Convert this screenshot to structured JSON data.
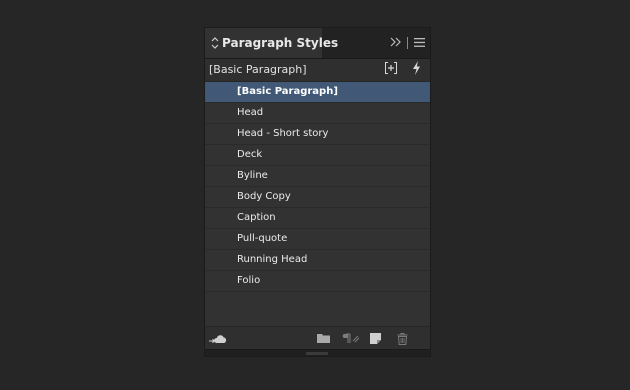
{
  "panel": {
    "tab_title": "Paragraph Styles",
    "current_style": "[Basic Paragraph]"
  },
  "styles": [
    {
      "label": "[Basic Paragraph]",
      "selected": true
    },
    {
      "label": "Head",
      "selected": false
    },
    {
      "label": "Head - Short story",
      "selected": false
    },
    {
      "label": "Deck",
      "selected": false
    },
    {
      "label": "Byline",
      "selected": false
    },
    {
      "label": "Body Copy",
      "selected": false
    },
    {
      "label": "Caption",
      "selected": false
    },
    {
      "label": "Pull-quote",
      "selected": false
    },
    {
      "label": "Running Head",
      "selected": false
    },
    {
      "label": "Folio",
      "selected": false
    }
  ],
  "icons": {
    "tab": "chevron-updown-icon",
    "collapse": "double-chevron-right-icon",
    "menu": "panel-menu-icon",
    "new_group": "new-style-group-icon",
    "quick_apply": "lightning-icon",
    "cc_libraries": "cloud-icon",
    "folder": "folder-icon",
    "clear_overrides": "clear-overrides-icon",
    "new_style": "new-style-icon",
    "delete": "trash-icon"
  },
  "colors": {
    "selection": "#415877",
    "panel_bg": "#323232",
    "app_bg": "#262626"
  }
}
